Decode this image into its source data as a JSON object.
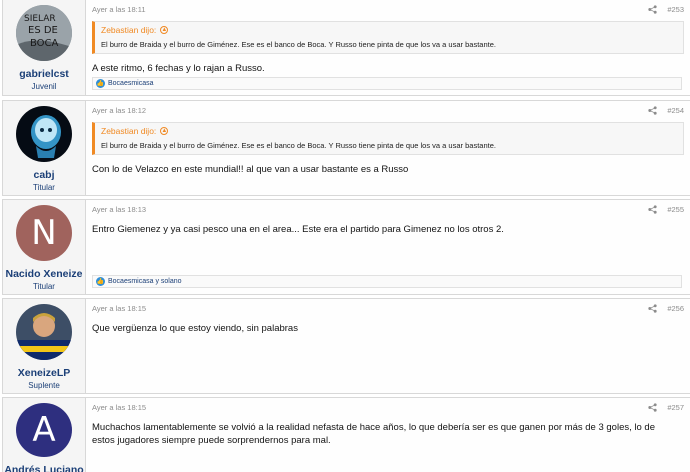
{
  "posts": [
    {
      "author": "gabrielcst",
      "user_title": "Juvenil",
      "time": "Ayer a las 18:11",
      "post_number": "#253",
      "quote": {
        "author": "Zebastian dijo:",
        "text": "El burro de Braida y el burro de Giménez. Ese es el banco de Boca. Y Russo tiene pinta de que los va a usar bastante."
      },
      "message": "A este ritmo, 6 fechas y lo rajan a Russo.",
      "reactions": "Bocaesmicasa",
      "avatar_text": "SIELAR ES DE BOCA"
    },
    {
      "author": "cabj",
      "user_title": "Titular",
      "time": "Ayer a las 18:12",
      "post_number": "#254",
      "quote": {
        "author": "Zebastian dijo:",
        "text": "El burro de Braida y el burro de Giménez. Ese es el banco de Boca. Y Russo tiene pinta de que los va a usar bastante."
      },
      "message": "Con lo de Velazco en este mundial!! al que van a usar bastante es a Russo"
    },
    {
      "author": "Nacido Xeneize",
      "user_title": "Titular",
      "time": "Ayer a las 18:13",
      "post_number": "#255",
      "message": "Entro Giemenez y ya casi pesco una en el area... Este era el partido para Gimenez no los otros 2.",
      "reactions": "Bocaesmicasa y solano",
      "avatar_letter": "N",
      "avatar_color": "#a0635d"
    },
    {
      "author": "XeneizeLP",
      "user_title": "Suplente",
      "time": "Ayer a las 18:15",
      "post_number": "#256",
      "message": "Que vergüenza lo que estoy viendo, sin palabras"
    },
    {
      "author": "Andrés Luciano",
      "time": "Ayer a las 18:15",
      "post_number": "#257",
      "message_line1": "Muchachos lamentablemente se volvió a la realidad nefasta de hace años, lo que debería ser es que ganen por más de 3 goles, lo de",
      "message_line2": "estos jugadores siempre puede sorprendernos para mal.",
      "avatar_letter": "A",
      "avatar_color": "#2e2f7f"
    }
  ],
  "colors": {
    "quote_accent": "#f08a24",
    "username": "#1b3f77",
    "like_blue": "#2f8fd8"
  },
  "icons": {
    "share": "share-icon",
    "quote_up": "arrow-up-circle-icon",
    "like": "like-icon"
  }
}
